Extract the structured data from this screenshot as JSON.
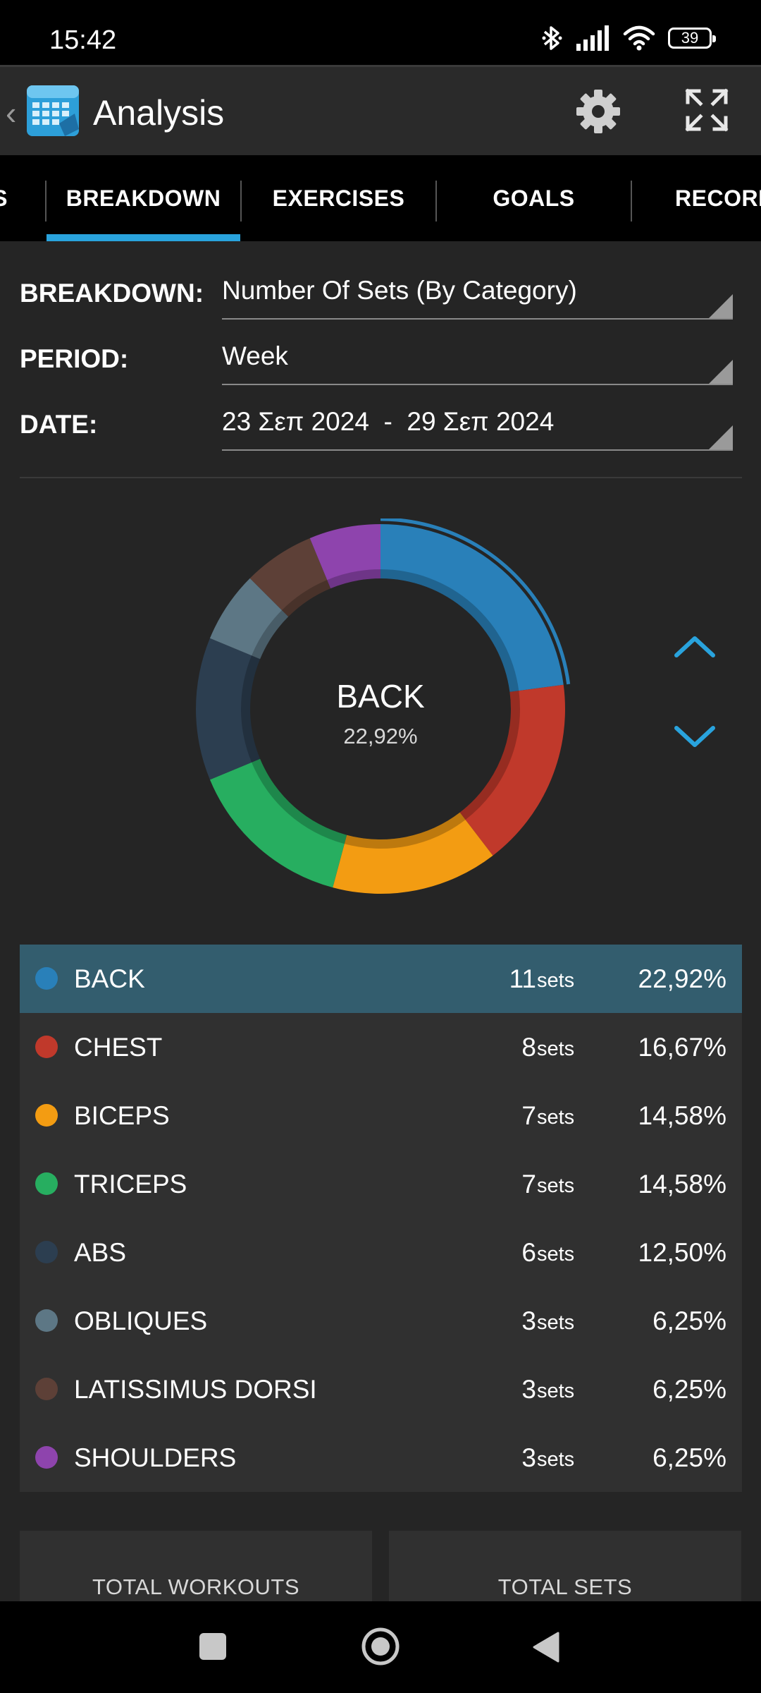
{
  "status_bar": {
    "time": "15:42",
    "battery": "39"
  },
  "app_bar": {
    "title": "Analysis"
  },
  "tabs": [
    {
      "label": "S"
    },
    {
      "label": "BREAKDOWN",
      "selected": true
    },
    {
      "label": "EXERCISES"
    },
    {
      "label": "GOALS"
    },
    {
      "label": "RECORD"
    }
  ],
  "filters": {
    "breakdown": {
      "label": "BREAKDOWN:",
      "value": "Number Of Sets (By Category)"
    },
    "period": {
      "label": "PERIOD:",
      "value": "Week"
    },
    "date": {
      "label": "DATE:",
      "value": "23 Σεπ 2024  -  29 Σεπ 2024"
    }
  },
  "donut": {
    "center_label": "BACK",
    "center_pct": "22,92%"
  },
  "chart_data": {
    "type": "pie",
    "categories": [
      "BACK",
      "CHEST",
      "BICEPS",
      "TRICEPS",
      "ABS",
      "OBLIQUES",
      "LATISSIMUS DORSI",
      "SHOULDERS"
    ],
    "values": [
      11,
      8,
      7,
      7,
      6,
      3,
      3,
      3
    ],
    "colors": [
      "#2980b9",
      "#c0392b",
      "#f39c12",
      "#27ae60",
      "#2c3e50",
      "#5d7785",
      "#5d4037",
      "#8e44ad"
    ],
    "selected": "BACK"
  },
  "breakdown_list": [
    {
      "name": "BACK",
      "count": "11",
      "unit": "sets",
      "pct": "22,92%",
      "color": "#2980b9",
      "selected": true
    },
    {
      "name": "CHEST",
      "count": "8",
      "unit": "sets",
      "pct": "16,67%",
      "color": "#c0392b"
    },
    {
      "name": "BICEPS",
      "count": "7",
      "unit": "sets",
      "pct": "14,58%",
      "color": "#f39c12"
    },
    {
      "name": "TRICEPS",
      "count": "7",
      "unit": "sets",
      "pct": "14,58%",
      "color": "#27ae60"
    },
    {
      "name": "ABS",
      "count": "6",
      "unit": "sets",
      "pct": "12,50%",
      "color": "#2c3e50"
    },
    {
      "name": "OBLIQUES",
      "count": "3",
      "unit": "sets",
      "pct": "6,25%",
      "color": "#5d7785"
    },
    {
      "name": "LATISSIMUS DORSI",
      "count": "3",
      "unit": "sets",
      "pct": "6,25%",
      "color": "#5d4037"
    },
    {
      "name": "SHOULDERS",
      "count": "3",
      "unit": "sets",
      "pct": "6,25%",
      "color": "#8e44ad"
    }
  ],
  "summary_cards": {
    "total_workouts": "TOTAL WORKOUTS",
    "total_sets": "TOTAL SETS"
  },
  "accent_color": "#29a3dd"
}
